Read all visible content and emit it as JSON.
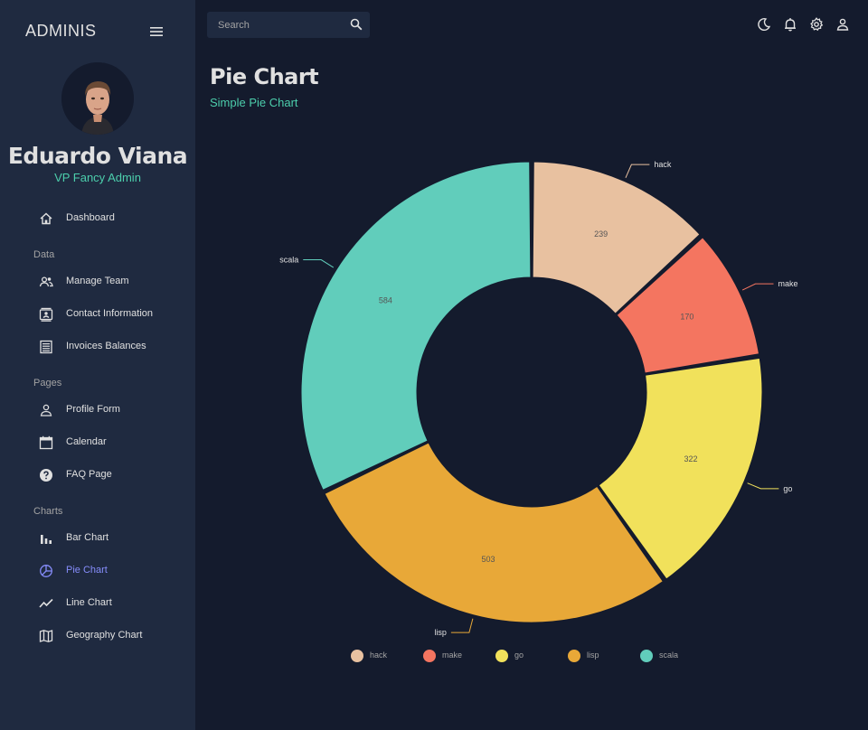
{
  "app": {
    "brand": "ADMINIS"
  },
  "profile": {
    "name": "Eduardo Viana",
    "role": "VP Fancy Admin"
  },
  "sidebar": {
    "items": [
      {
        "label": "Dashboard",
        "icon": "home-icon"
      },
      {
        "label": "Manage Team",
        "icon": "team-icon"
      },
      {
        "label": "Contact Information",
        "icon": "contacts-icon"
      },
      {
        "label": "Invoices Balances",
        "icon": "receipt-icon"
      },
      {
        "label": "Profile Form",
        "icon": "person-icon"
      },
      {
        "label": "Calendar",
        "icon": "calendar-icon"
      },
      {
        "label": "FAQ Page",
        "icon": "help-icon"
      },
      {
        "label": "Bar Chart",
        "icon": "bar-chart-icon"
      },
      {
        "label": "Pie Chart",
        "icon": "pie-chart-icon",
        "active": true
      },
      {
        "label": "Line Chart",
        "icon": "line-chart-icon"
      },
      {
        "label": "Geography Chart",
        "icon": "map-icon"
      }
    ],
    "sections": [
      "Data",
      "Pages",
      "Charts"
    ]
  },
  "search": {
    "placeholder": "Search"
  },
  "header": {
    "title": "Pie Chart",
    "subtitle": "Simple Pie Chart"
  },
  "colors": {
    "accent": "#4cceac",
    "active": "#868dfb",
    "background": "#141b2d",
    "panel": "#1f2a40"
  },
  "chart_data": {
    "type": "pie",
    "donut": true,
    "categories": [
      "hack",
      "make",
      "go",
      "lisp",
      "scala"
    ],
    "values": [
      239,
      170,
      322,
      503,
      584
    ],
    "colors": [
      "#e8c1a0",
      "#f47560",
      "#f1e15b",
      "#e8a838",
      "#61cdbb"
    ],
    "legend": "bottom"
  }
}
